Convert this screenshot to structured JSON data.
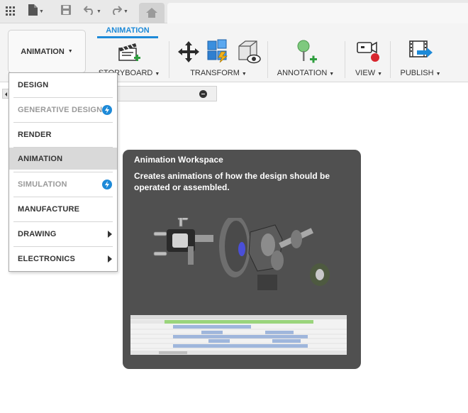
{
  "quick_access": {
    "apps_icon": "grid-icon",
    "file_icon": "document-icon",
    "save_icon": "floppy-disk-icon",
    "undo_icon": "undo-icon",
    "redo_icon": "redo-icon",
    "home_icon": "home-icon"
  },
  "ribbon": {
    "workspace_button": "ANIMATION",
    "active_tab": "ANIMATION",
    "groups": [
      {
        "label": "STORYBOARD",
        "icon": "clapperboard-add-icon"
      },
      {
        "label": "TRANSFORM",
        "icon": "move-arrows-icon"
      },
      {
        "label": "ANNOTATION",
        "icon": "pushpin-add-icon"
      },
      {
        "label": "VIEW",
        "icon": "camera-record-icon"
      },
      {
        "label": "PUBLISH",
        "icon": "film-export-icon"
      }
    ],
    "extra_tools": [
      "auto-explode-icon",
      "show-hide-cube-icon"
    ]
  },
  "workspace_menu": {
    "items": [
      {
        "label": "DESIGN",
        "state": "enabled"
      },
      {
        "label": "GENERATIVE DESIGN",
        "state": "disabled",
        "badge": "lightning-badge-icon"
      },
      {
        "label": "RENDER",
        "state": "enabled"
      },
      {
        "label": "ANIMATION",
        "state": "selected"
      },
      {
        "label": "SIMULATION",
        "state": "disabled",
        "badge": "lightning-badge-icon"
      },
      {
        "label": "MANUFACTURE",
        "state": "enabled"
      },
      {
        "label": "DRAWING",
        "state": "enabled",
        "submenu": true
      },
      {
        "label": "ELECTRONICS",
        "state": "enabled",
        "submenu": true
      }
    ]
  },
  "tooltip": {
    "title": "Animation Workspace",
    "description": "Creates animations of how the design should be operated or assembled."
  },
  "colors": {
    "accent": "#1e8ad8",
    "tooltip_bg": "#505050",
    "selected_bg": "#d9d9d9"
  }
}
